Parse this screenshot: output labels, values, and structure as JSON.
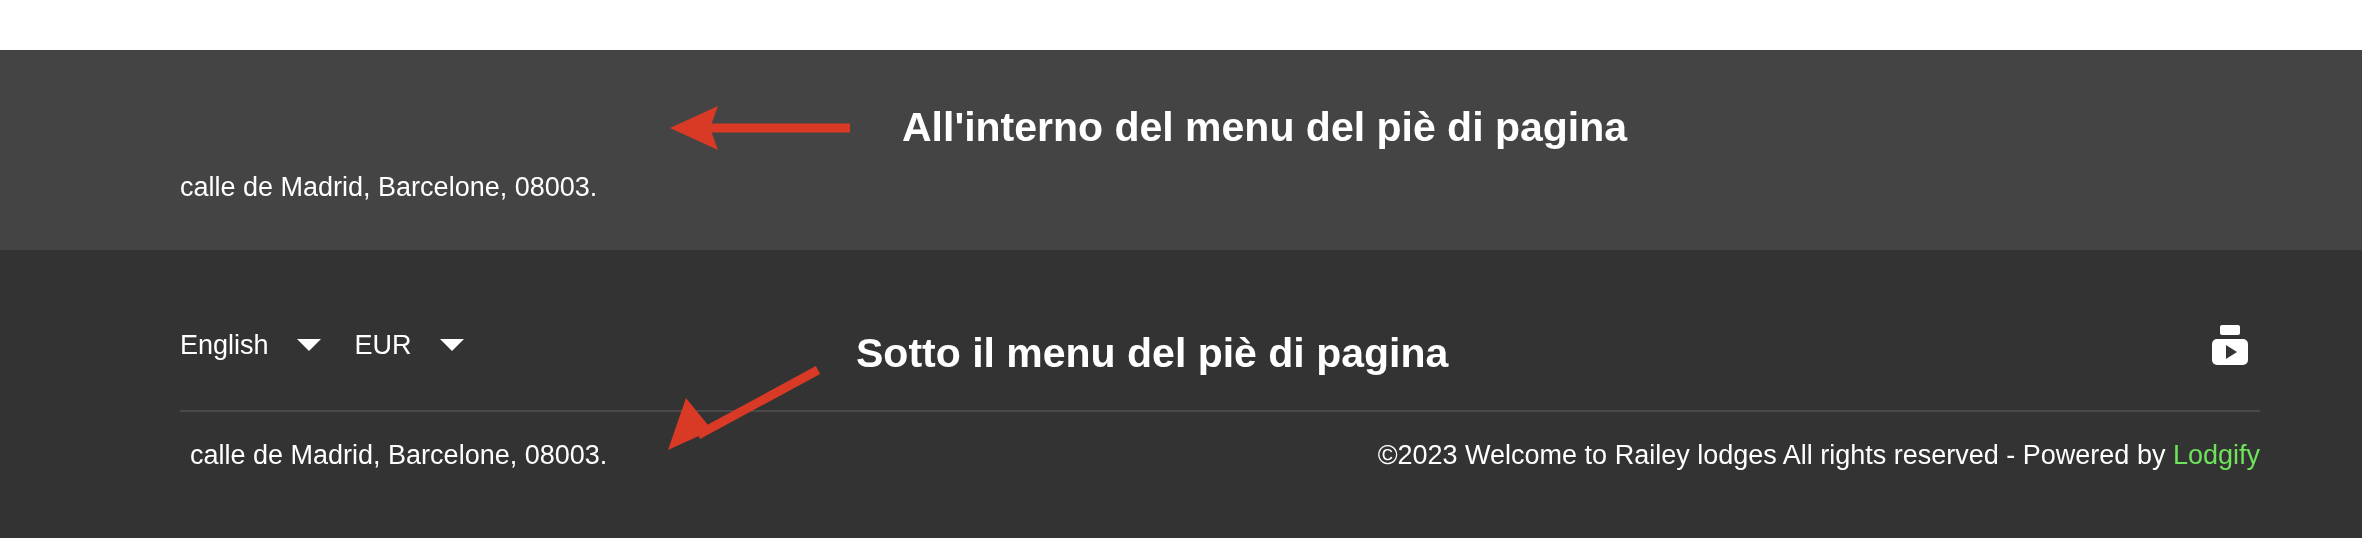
{
  "menu_footer": {
    "address": "calle de Madrid, Barcelone, 08003."
  },
  "footer": {
    "language": {
      "value": "English"
    },
    "currency": {
      "value": "EUR"
    },
    "address": "calle de Madrid, Barcelone, 08003.",
    "copyright": "©2023 Welcome to Railey lodges All rights reserved - Powered by",
    "link": "Lodgify"
  },
  "annotations": [
    {
      "text": "All'interno del menu del piè di pagina",
      "kind": "left"
    },
    {
      "text": "Sotto il menu del piè di pagina",
      "kind": "diagonal"
    }
  ]
}
